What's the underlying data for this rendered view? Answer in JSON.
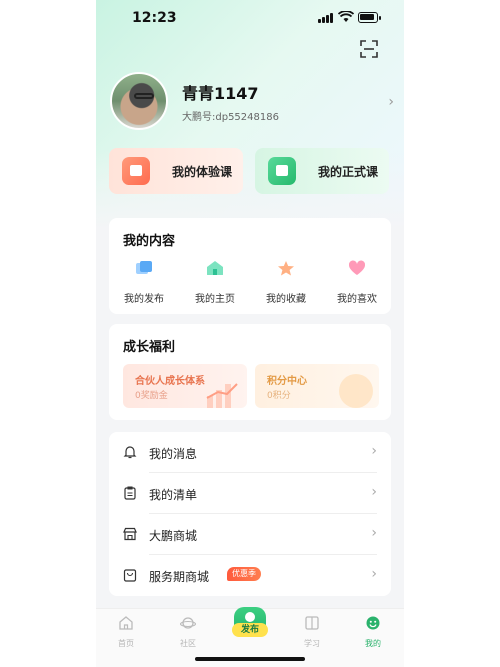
{
  "status_bar": {
    "time": "12:23"
  },
  "profile": {
    "name": "青青1147",
    "id_text": "大鹏号:dp55248186"
  },
  "courses": [
    {
      "label": "我的体验课",
      "icon": "tv-icon",
      "accent": "#ff6b4f"
    },
    {
      "label": "我的正式课",
      "icon": "book-icon",
      "accent": "#25b96c"
    }
  ],
  "my_content": {
    "title": "我的内容",
    "items": [
      {
        "label": "我的发布",
        "icon": "publish-icon",
        "color": "#6fb3ff"
      },
      {
        "label": "我的主页",
        "icon": "homepage-icon",
        "color": "#3ccf9e"
      },
      {
        "label": "我的收藏",
        "icon": "star-icon",
        "color": "#ffab7a"
      },
      {
        "label": "我的喜欢",
        "icon": "heart-icon",
        "color": "#ff8fb1"
      }
    ]
  },
  "growth": {
    "title": "成长福利",
    "partner": {
      "title": "合伙人成长体系",
      "sub": "0奖励金"
    },
    "points": {
      "title": "积分中心",
      "sub": "0积分"
    }
  },
  "menu": [
    {
      "label": "我的消息",
      "icon": "bell-icon"
    },
    {
      "label": "我的清单",
      "icon": "clipboard-icon"
    },
    {
      "label": "大鹏商城",
      "icon": "store-icon"
    },
    {
      "label": "服务期商城",
      "icon": "bag-icon",
      "badge": "优惠季"
    }
  ],
  "tab_bar": {
    "tabs": [
      {
        "label": "首页",
        "icon": "home-icon",
        "active": false
      },
      {
        "label": "社区",
        "icon": "planet-icon",
        "active": false
      },
      {
        "label": "学习",
        "icon": "book-open-icon",
        "active": false
      },
      {
        "label": "我的",
        "icon": "smile-icon",
        "active": true
      }
    ],
    "publish_label": "发布"
  },
  "colors": {
    "accent": "#2ab26c",
    "badge": "#ff5a3c"
  }
}
